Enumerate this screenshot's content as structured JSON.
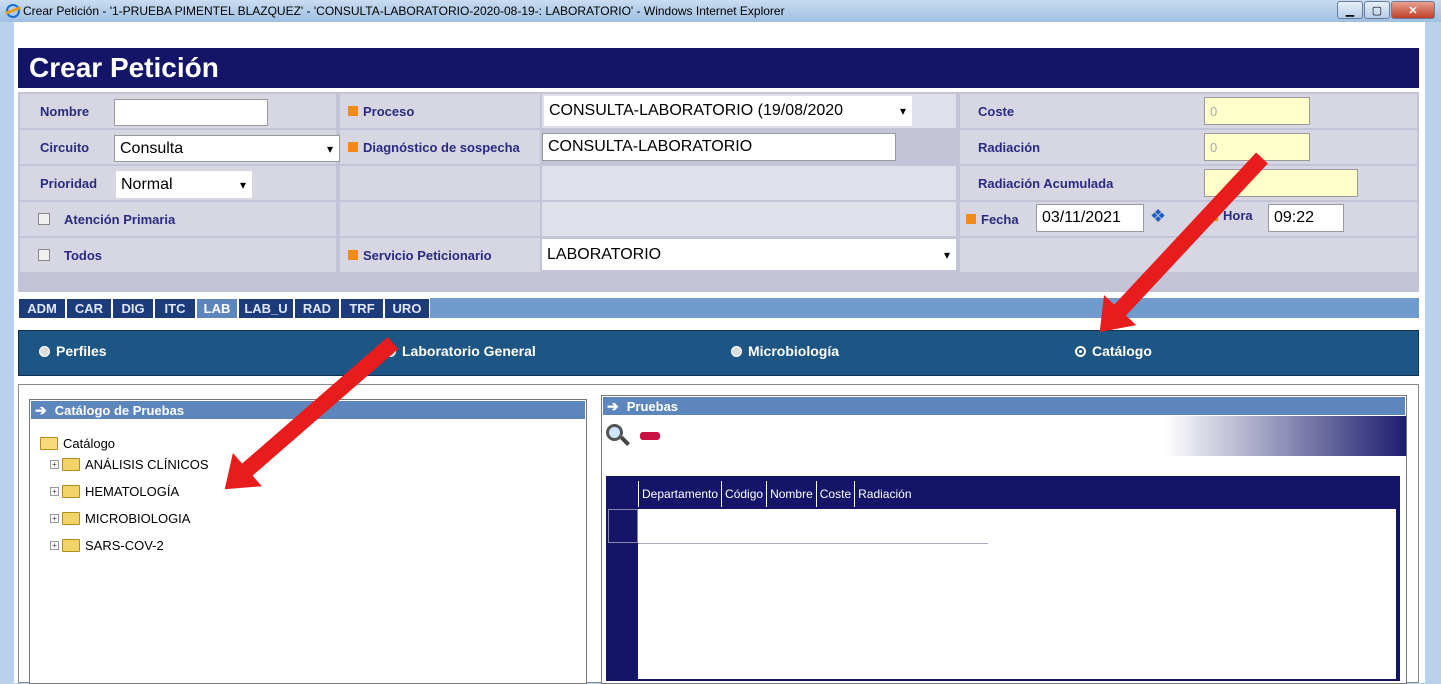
{
  "window": {
    "title": "Crear Petición - '1-PRUEBA PIMENTEL BLAZQUEZ' - 'CONSULTA-LABORATORIO-2020-08-19-: LABORATORIO' - Windows Internet Explorer"
  },
  "page_title": "Crear Petición",
  "form": {
    "nombre_label": "Nombre",
    "nombre_value": "",
    "circuito_label": "Circuito",
    "circuito_value": "Consulta",
    "prioridad_label": "Prioridad",
    "prioridad_value": "Normal",
    "atencion_label": "Atención Primaria",
    "todos_label": "Todos",
    "proceso_label": "Proceso",
    "proceso_value": "CONSULTA-LABORATORIO (19/08/2020",
    "diag_label": "Diagnóstico de sospecha",
    "diag_value": "CONSULTA-LABORATORIO",
    "servicio_label": "Servicio Peticionario",
    "servicio_value": "LABORATORIO",
    "coste_label": "Coste",
    "coste_value": "0",
    "radiacion_label": "Radiación",
    "radiacion_value": "0",
    "radiacion_acum_label": "Radiación Acumulada",
    "radiacion_acum_value": "",
    "fecha_label": "Fecha",
    "fecha_value": "03/11/2021",
    "hora_label": "Hora",
    "hora_value": "09:22"
  },
  "tabs": [
    "ADM",
    "CAR",
    "DIG",
    "ITC",
    "LAB",
    "LAB_U",
    "RAD",
    "TRF",
    "URO"
  ],
  "active_tab": "LAB",
  "radio_options": [
    "Perfiles",
    "Laboratorio General",
    "Microbiología",
    "Catálogo"
  ],
  "selected_radio": "Catálogo",
  "catalog_panel": {
    "title": "Catálogo de Pruebas",
    "root": "Catálogo",
    "items": [
      "ANÁLISIS CLÍNICOS",
      "HEMATOLOGÍA",
      "MICROBIOLOGIA",
      "SARS-COV-2"
    ]
  },
  "pruebas_panel": {
    "title": "Pruebas",
    "columns": [
      "Departamento",
      "Código",
      "Nombre",
      "Coste",
      "Radiación"
    ]
  },
  "colors": {
    "header": "#141468",
    "accent": "#f08b1a",
    "annotation_arrow": "#e81c1c"
  }
}
